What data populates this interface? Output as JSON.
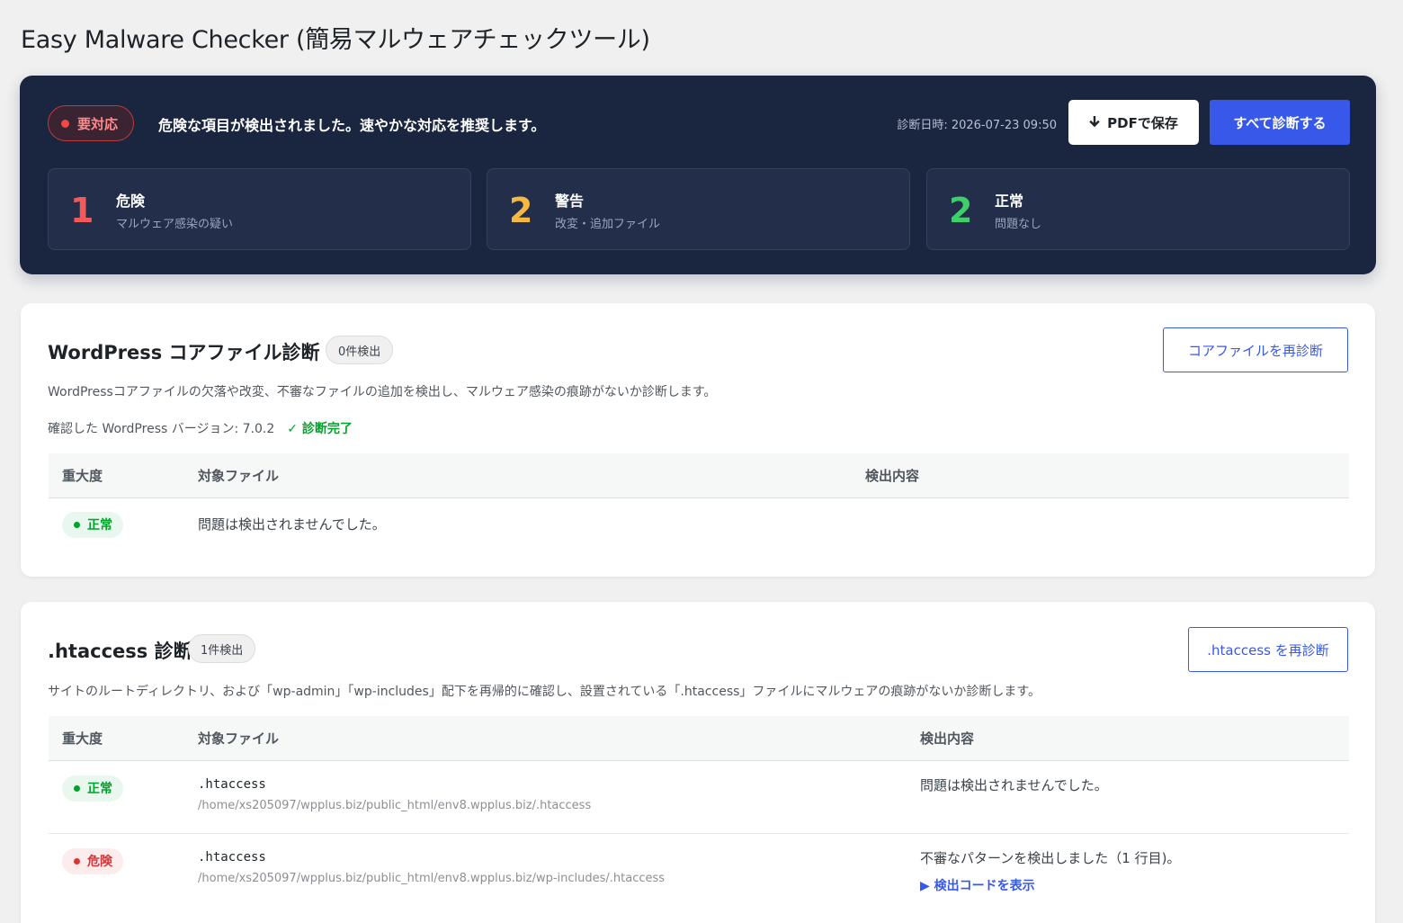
{
  "page": {
    "title": "Easy Malware Checker (簡易マルウェアチェックツール)"
  },
  "summary": {
    "status_label": "要対応",
    "message": "危険な項目が検出されました。速やかな対応を推奨します。",
    "diagnosis_date": "診断日時: 2026-07-23 09:50",
    "pdf_button": "PDFで保存",
    "pdf_icon": "download-arrow-icon",
    "scan_all_button": "すべて診断する",
    "stats": [
      {
        "count": "1",
        "label": "危険",
        "sub": "マルウェア感染の疑い",
        "color": "#f05a5a"
      },
      {
        "count": "2",
        "label": "警告",
        "sub": "改変・追加ファイル",
        "color": "#f5b840"
      },
      {
        "count": "2",
        "label": "正常",
        "sub": "問題なし",
        "color": "#3ecf6a"
      }
    ]
  },
  "core": {
    "title": "WordPress コアファイル診断",
    "badge": "0件検出",
    "rescan_button": "コアファイルを再診断",
    "description": "WordPressコアファイルの欠落や改変、不審なファイルの追加を検出し、マルウェア感染の痕跡がないか診断します。",
    "version_label": "確認した WordPress バージョン: 7.0.2",
    "status_done": "✓ 診断完了",
    "columns": [
      "重大度",
      "対象ファイル",
      "検出内容"
    ],
    "rows": [
      {
        "severity": "正常",
        "message": "問題は検出されませんでした。"
      }
    ]
  },
  "htaccess": {
    "title": ".htaccess 診断",
    "badge": "1件検出",
    "rescan_button": ".htaccess を再診断",
    "description": "サイトのルートディレクトリ、および「wp-admin」「wp-includes」配下を再帰的に確認し、設置されている「.htaccess」ファイルにマルウェアの痕跡がないか診断します。",
    "columns": [
      "重大度",
      "対象ファイル",
      "検出内容"
    ],
    "rows": [
      {
        "severity": "正常",
        "file": ".htaccess",
        "path": "/home/xs205097/wpplus.biz/public_html/env8.wpplus.biz/.htaccess",
        "detection": "問題は検出されませんでした。"
      },
      {
        "severity": "危険",
        "file": ".htaccess",
        "path": "/home/xs205097/wpplus.biz/public_html/env8.wpplus.biz/wp-includes/.htaccess",
        "detection": "不審なパターンを検出しました（1 行目)。",
        "show_code": "▶ 検出コードを表示"
      }
    ]
  }
}
